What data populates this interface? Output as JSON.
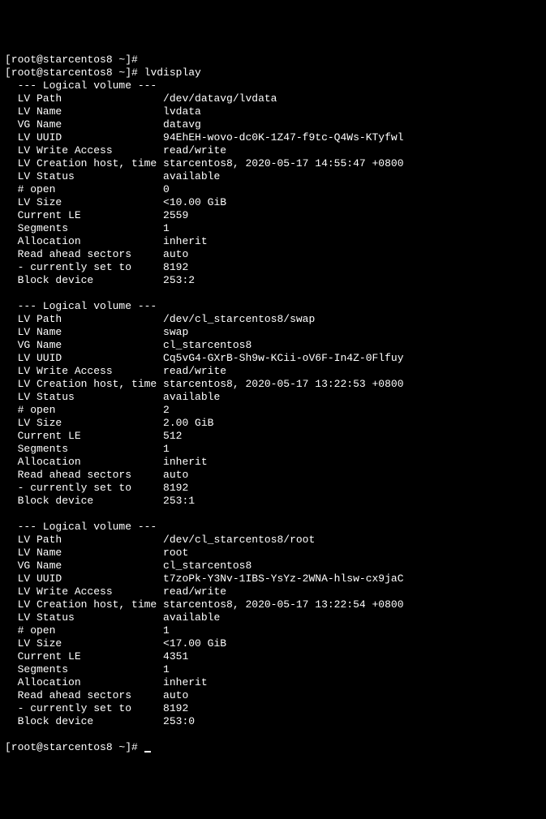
{
  "top_line": "[root@starcentos8 ~]#",
  "prompt": "[root@starcentos8 ~]# ",
  "command": "lvdisplay",
  "section_header": "  --- Logical volume ---",
  "blank": " ",
  "volumes": [
    {
      "lv_path_label": "  LV Path                ",
      "lv_path": "/dev/datavg/lvdata",
      "lv_name_label": "  LV Name                ",
      "lv_name": "lvdata",
      "vg_name_label": "  VG Name                ",
      "vg_name": "datavg",
      "lv_uuid_label": "  LV UUID                ",
      "lv_uuid": "94EhEH-wovo-dc0K-1Z47-f9tc-Q4Ws-KTyfwl",
      "write_access_label": "  LV Write Access        ",
      "write_access": "read/write",
      "creation_label": "  LV Creation host, time ",
      "creation": "starcentos8, 2020-05-17 14:55:47 +0800",
      "status_label": "  LV Status              ",
      "status": "available",
      "open_label": "  # open                 ",
      "open": "0",
      "size_label": "  LV Size                ",
      "size": "<10.00 GiB",
      "le_label": "  Current LE             ",
      "le": "2559",
      "segments_label": "  Segments               ",
      "segments": "1",
      "allocation_label": "  Allocation             ",
      "allocation": "inherit",
      "read_ahead_label": "  Read ahead sectors     ",
      "read_ahead": "auto",
      "currently_label": "  - currently set to     ",
      "currently": "8192",
      "block_label": "  Block device           ",
      "block": "253:2"
    },
    {
      "lv_path_label": "  LV Path                ",
      "lv_path": "/dev/cl_starcentos8/swap",
      "lv_name_label": "  LV Name                ",
      "lv_name": "swap",
      "vg_name_label": "  VG Name                ",
      "vg_name": "cl_starcentos8",
      "lv_uuid_label": "  LV UUID                ",
      "lv_uuid": "Cq5vG4-GXrB-Sh9w-KCii-oV6F-In4Z-0Flfuy",
      "write_access_label": "  LV Write Access        ",
      "write_access": "read/write",
      "creation_label": "  LV Creation host, time ",
      "creation": "starcentos8, 2020-05-17 13:22:53 +0800",
      "status_label": "  LV Status              ",
      "status": "available",
      "open_label": "  # open                 ",
      "open": "2",
      "size_label": "  LV Size                ",
      "size": "2.00 GiB",
      "le_label": "  Current LE             ",
      "le": "512",
      "segments_label": "  Segments               ",
      "segments": "1",
      "allocation_label": "  Allocation             ",
      "allocation": "inherit",
      "read_ahead_label": "  Read ahead sectors     ",
      "read_ahead": "auto",
      "currently_label": "  - currently set to     ",
      "currently": "8192",
      "block_label": "  Block device           ",
      "block": "253:1"
    },
    {
      "lv_path_label": "  LV Path                ",
      "lv_path": "/dev/cl_starcentos8/root",
      "lv_name_label": "  LV Name                ",
      "lv_name": "root",
      "vg_name_label": "  VG Name                ",
      "vg_name": "cl_starcentos8",
      "lv_uuid_label": "  LV UUID                ",
      "lv_uuid": "t7zoPk-Y3Nv-1IBS-YsYz-2WNA-hlsw-cx9jaC",
      "write_access_label": "  LV Write Access        ",
      "write_access": "read/write",
      "creation_label": "  LV Creation host, time ",
      "creation": "starcentos8, 2020-05-17 13:22:54 +0800",
      "status_label": "  LV Status              ",
      "status": "available",
      "open_label": "  # open                 ",
      "open": "1",
      "size_label": "  LV Size                ",
      "size": "<17.00 GiB",
      "le_label": "  Current LE             ",
      "le": "4351",
      "segments_label": "  Segments               ",
      "segments": "1",
      "allocation_label": "  Allocation             ",
      "allocation": "inherit",
      "read_ahead_label": "  Read ahead sectors     ",
      "read_ahead": "auto",
      "currently_label": "  - currently set to     ",
      "currently": "8192",
      "block_label": "  Block device           ",
      "block": "253:0"
    }
  ],
  "end_prompt": "[root@starcentos8 ~]# "
}
